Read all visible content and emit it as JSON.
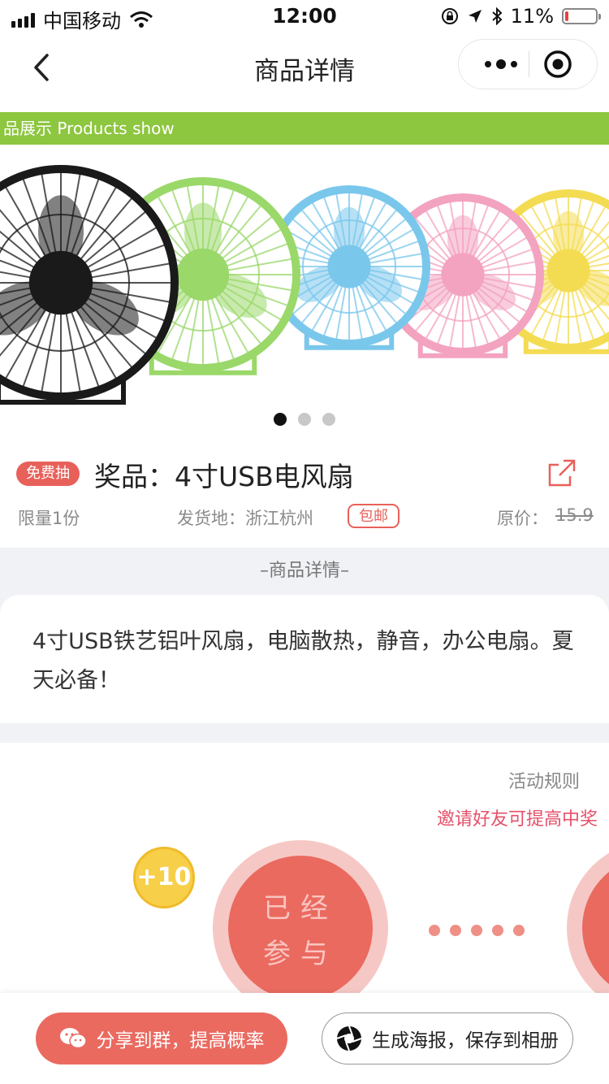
{
  "status_bar": {
    "carrier": "中国移动",
    "time": "12:00",
    "battery": "11%",
    "battery_level": 0.11
  },
  "nav": {
    "title": "商品详情"
  },
  "banner": {
    "strip_text": "品展示 Products show",
    "fan_colors": [
      "#1a1a1a",
      "#9ad86a",
      "#7ac7ec",
      "#f3a2c0",
      "#f4dc52"
    ],
    "slides_total": 3,
    "active_slide": 1
  },
  "product": {
    "badge": "免费抽",
    "title": "奖品：4寸USB电风扇",
    "limit": "限量1份",
    "ship_from": "发货地：浙江杭州",
    "shipping_tag": "包邮",
    "orig_price_label": "原价：",
    "orig_price": "15.9"
  },
  "details": {
    "header": "–商品详情–",
    "text": "4寸USB铁艺铝叶风扇，电脑散热，静音，办公电扇。夏天必备！"
  },
  "activity": {
    "rules": "活动规则",
    "invite_tip": "邀请好友可提高中奖",
    "bonus": "+10",
    "joined_line1": "已经",
    "joined_line2": "参与"
  },
  "bottom": {
    "share_label": "分享到群，提高概率",
    "poster_label": "生成海报，保存到相册"
  },
  "colors": {
    "accent": "#ea6a60",
    "banner_green": "#8dc63f",
    "invite_red": "#e5506a",
    "coin_yellow": "#f7cf48"
  }
}
